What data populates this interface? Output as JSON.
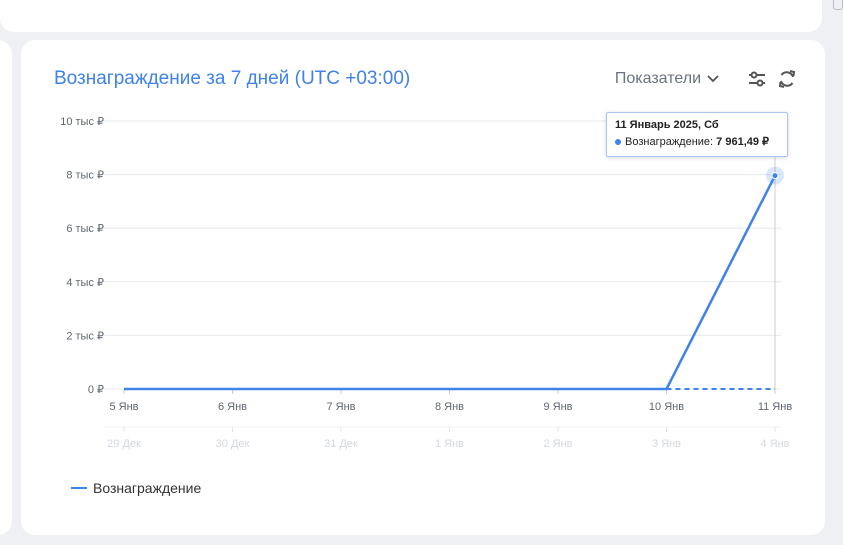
{
  "card": {
    "title": "Вознаграждение за 7 дней (UTC +03:00)",
    "metrics_label": "Показатели"
  },
  "tooltip": {
    "date": "11 Январь 2025, Сб",
    "series_label": "Вознаграждение:",
    "value": "7 961,49 ₽"
  },
  "legend": {
    "label": "Вознаграждение"
  },
  "colors": {
    "accent": "#3f82ea"
  },
  "chart_data": {
    "type": "line",
    "categories": [
      "5 Янв",
      "6 Янв",
      "7 Янв",
      "8 Янв",
      "9 Янв",
      "10 Янв",
      "11 Янв"
    ],
    "compare_categories": [
      "29 Дек",
      "30 Дек",
      "31 Дек",
      "1 Янв",
      "2 Янв",
      "3 Янв",
      "4 Янв"
    ],
    "series": [
      {
        "name": "Вознаграждение",
        "values": [
          0,
          0,
          0,
          0,
          0,
          0,
          7961.49
        ]
      }
    ],
    "comparison_values": [
      0,
      0,
      0,
      0,
      0,
      0,
      0
    ],
    "y_ticks": [
      "0 ₽",
      "2 тыс ₽",
      "4 тыс ₽",
      "6 тыс ₽",
      "8 тыс ₽",
      "10 тыс ₽"
    ],
    "ylim": [
      0,
      10000
    ],
    "grid": true,
    "legend_position": "bottom-left"
  }
}
